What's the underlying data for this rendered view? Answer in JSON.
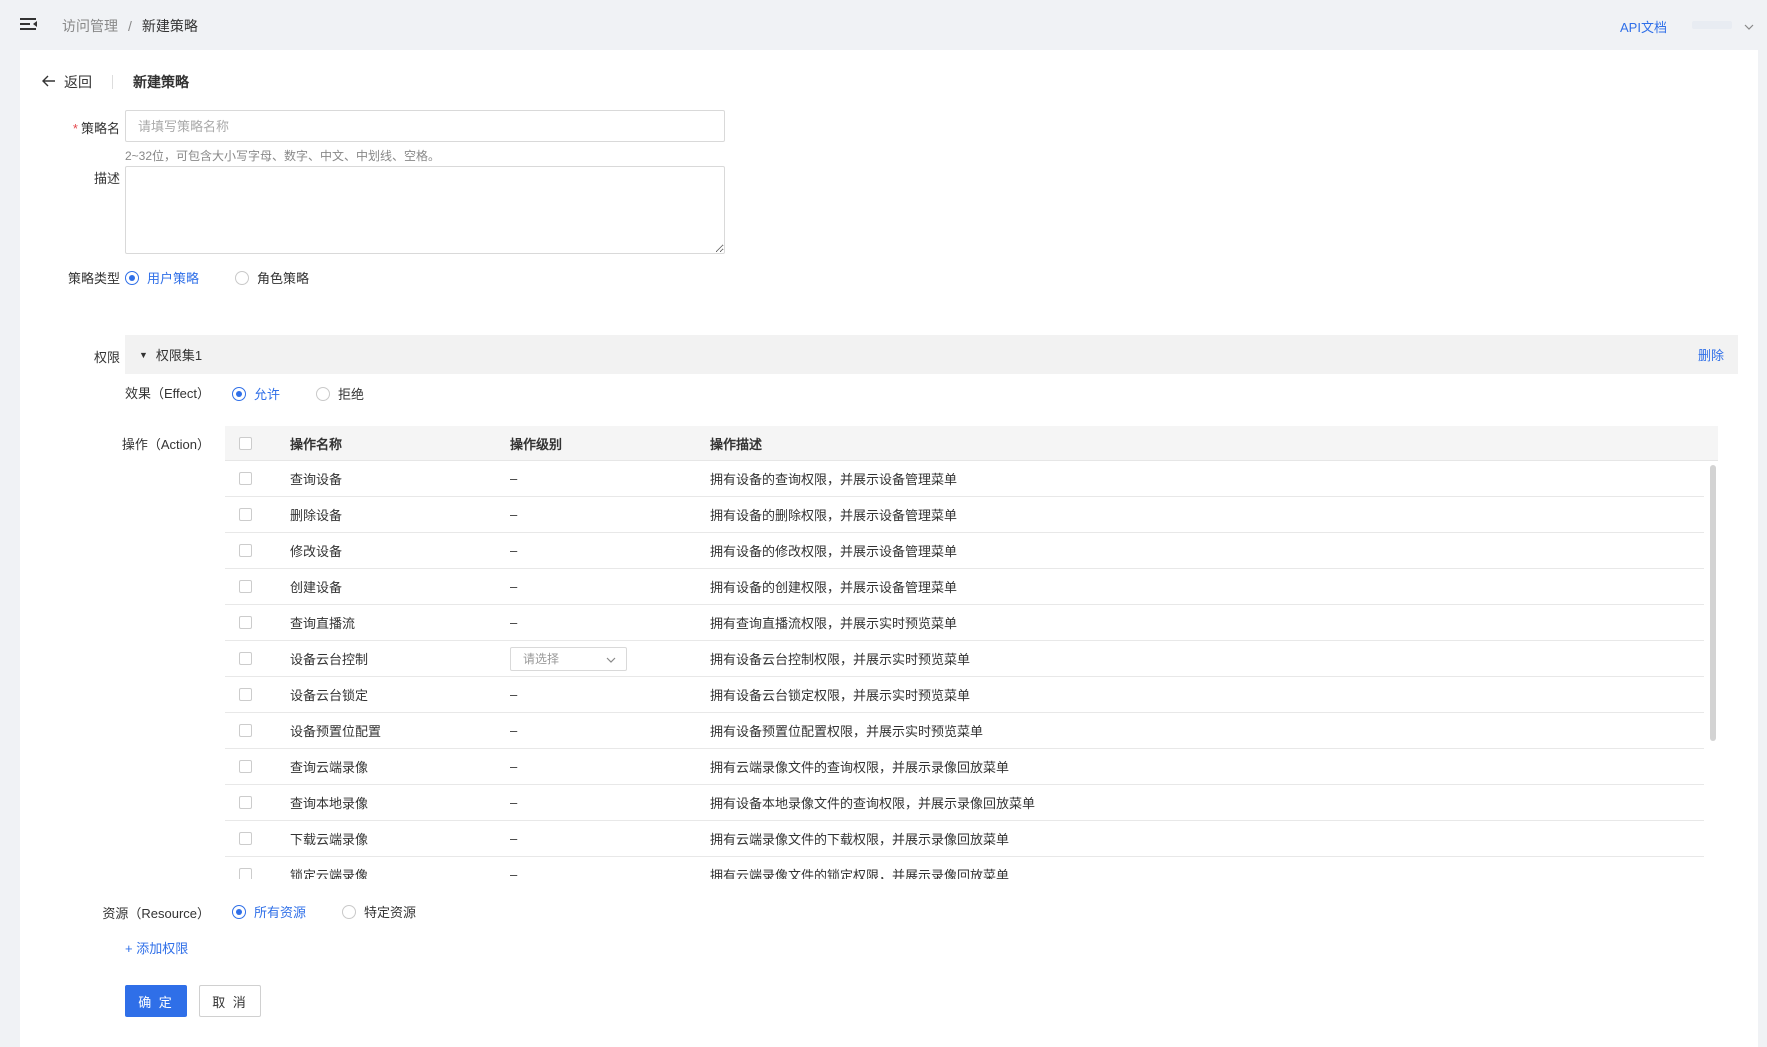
{
  "topbar": {
    "menu_icon": "menu-fold-icon",
    "breadcrumb": [
      "访问管理",
      "新建策略"
    ],
    "breadcrumb_sep": "/",
    "api_doc": "API文档"
  },
  "header": {
    "back_label": "返回",
    "title": "新建策略"
  },
  "form": {
    "name_label": "策略名",
    "name_required": "*",
    "name_placeholder": "请填写策略名称",
    "name_value": "",
    "name_hint": "2~32位，可包含大小写字母、数字、中文、中划线、空格。",
    "desc_label": "描述",
    "desc_value": "",
    "type_label": "策略类型",
    "type_options": [
      "用户策略",
      "角色策略"
    ],
    "type_selected": "用户策略",
    "perm_label": "权限"
  },
  "permission_set": {
    "title": "权限集1",
    "delete_label": "删除",
    "effect_label": "效果（Effect）",
    "effect_options": [
      "允许",
      "拒绝"
    ],
    "effect_selected": "允许",
    "action_label": "操作（Action）",
    "columns": [
      "操作名称",
      "操作级别",
      "操作描述"
    ],
    "rows": [
      {
        "name": "查询设备",
        "level": "–",
        "desc": "拥有设备的查询权限，并展示设备管理菜单"
      },
      {
        "name": "删除设备",
        "level": "–",
        "desc": "拥有设备的删除权限，并展示设备管理菜单"
      },
      {
        "name": "修改设备",
        "level": "–",
        "desc": "拥有设备的修改权限，并展示设备管理菜单"
      },
      {
        "name": "创建设备",
        "level": "–",
        "desc": "拥有设备的创建权限，并展示设备管理菜单"
      },
      {
        "name": "查询直播流",
        "level": "–",
        "desc": "拥有查询直播流权限，并展示实时预览菜单"
      },
      {
        "name": "设备云台控制",
        "level": "请选择",
        "desc": "拥有设备云台控制权限，并展示实时预览菜单"
      },
      {
        "name": "设备云台锁定",
        "level": "–",
        "desc": "拥有设备云台锁定权限，并展示实时预览菜单"
      },
      {
        "name": "设备预置位配置",
        "level": "–",
        "desc": "拥有设备预置位配置权限，并展示实时预览菜单"
      },
      {
        "name": "查询云端录像",
        "level": "–",
        "desc": "拥有云端录像文件的查询权限，并展示录像回放菜单"
      },
      {
        "name": "查询本地录像",
        "level": "–",
        "desc": "拥有设备本地录像文件的查询权限，并展示录像回放菜单"
      },
      {
        "name": "下载云端录像",
        "level": "–",
        "desc": "拥有云端录像文件的下载权限，并展示录像回放菜单"
      },
      {
        "name": "锁定云端录像",
        "level": "–",
        "desc": "拥有云端录像文件的锁定权限，并展示录像回放菜单"
      }
    ],
    "resource_label": "资源（Resource）",
    "resource_options": [
      "所有资源",
      "特定资源"
    ],
    "resource_selected": "所有资源"
  },
  "actions": {
    "add_permission": "+ 添加权限",
    "ok": "确 定",
    "cancel": "取 消"
  },
  "colors": {
    "accent": "#2f6fe8",
    "required": "#e5484d"
  }
}
